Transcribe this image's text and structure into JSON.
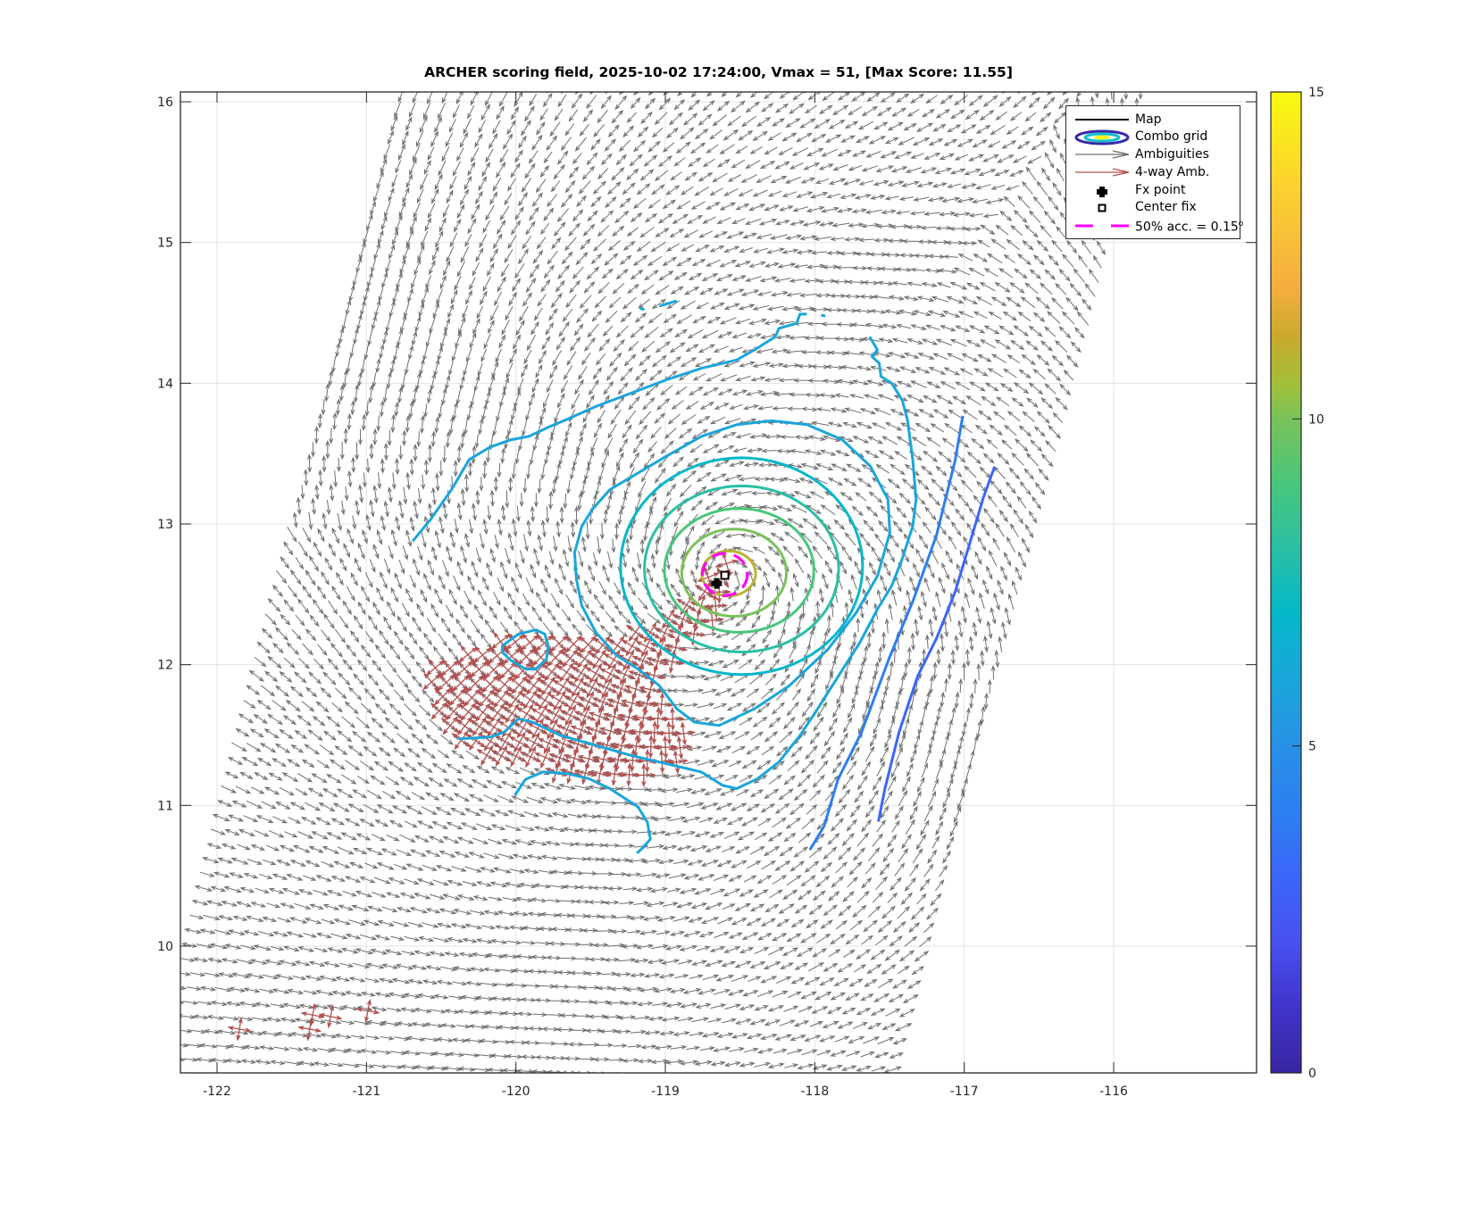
{
  "chart_data": {
    "type": "contour",
    "title": "ARCHER scoring field, 2025-10-02 17:24:00, Vmax = 51, [Max Score: 11.55]",
    "xlabel": "",
    "ylabel": "",
    "xlim": [
      -122.245,
      -115.044
    ],
    "ylim": [
      9.099,
      16.07
    ],
    "grid": true,
    "xticks": [
      -122,
      -121,
      -120,
      -119,
      -118,
      -117,
      -116
    ],
    "xtick_labels": [
      "-122",
      "-121",
      "-120",
      "-119",
      "-118",
      "-117",
      "-116"
    ],
    "yticks": [
      10,
      11,
      12,
      13,
      14,
      15,
      16
    ],
    "ytick_labels": [
      "10",
      "11",
      "12",
      "13",
      "14",
      "15",
      "16"
    ],
    "legend": {
      "placement": "top-right",
      "entries": [
        {
          "label": "Map",
          "symbol": "line"
        },
        {
          "label": "Combo grid",
          "symbol": "ellipses"
        },
        {
          "label": "Ambiguities",
          "symbol": "gray-arrow"
        },
        {
          "label": "4-way Amb.",
          "symbol": "red-arrow"
        },
        {
          "label": "Fx point",
          "symbol": "filled-marker"
        },
        {
          "label": "Center fix",
          "symbol": "open-square"
        },
        {
          "label": "50% acc. = 0.15",
          "sup": "o",
          "symbol": "magenta-dash"
        }
      ]
    },
    "colorbar": {
      "range": [
        0,
        15
      ],
      "ticks": [
        0,
        5,
        10,
        15
      ],
      "tick_labels": [
        "0",
        "5",
        "10",
        "15"
      ],
      "colormap": [
        [
          0,
          "#3826a0"
        ],
        [
          0.07,
          "#4034cc"
        ],
        [
          0.13,
          "#4850ee"
        ],
        [
          0.2,
          "#3c66f8"
        ],
        [
          0.27,
          "#2c80f0"
        ],
        [
          0.33,
          "#2890e6"
        ],
        [
          0.4,
          "#1aa6da"
        ],
        [
          0.47,
          "#04b8c8"
        ],
        [
          0.53,
          "#28bfa6"
        ],
        [
          0.6,
          "#48c67c"
        ],
        [
          0.667,
          "#7ac25a"
        ],
        [
          0.7,
          "#a0c03a"
        ],
        [
          0.75,
          "#c8aa2c"
        ],
        [
          0.8,
          "#f4ae40"
        ],
        [
          0.9,
          "#fcd030"
        ],
        [
          1,
          "#f9fa10"
        ]
      ]
    },
    "contours": [
      {
        "level": 11,
        "shape": "ellipse",
        "center": [
          -118.576,
          12.648
        ],
        "radii": [
          0.18,
          0.16
        ]
      },
      {
        "level": 10,
        "shape": "ellipse",
        "center": [
          -118.54,
          12.654
        ],
        "radii": [
          0.35,
          0.31
        ]
      },
      {
        "level": 9,
        "shape": "ellipse",
        "center": [
          -118.506,
          12.67
        ],
        "radii": [
          0.5,
          0.44
        ]
      },
      {
        "level": 8,
        "shape": "ellipse",
        "center": [
          -118.49,
          12.68
        ],
        "radii": [
          0.65,
          0.59
        ]
      },
      {
        "level": 7,
        "shape": "ellipse",
        "center": [
          -118.49,
          12.7
        ],
        "radii": [
          0.81,
          0.77
        ]
      },
      {
        "level": 6,
        "closed": true,
        "points": [
          [
            -119.489,
            13.103
          ],
          [
            -119.371,
            13.244
          ],
          [
            -119.183,
            13.362
          ],
          [
            -118.994,
            13.481
          ],
          [
            -118.759,
            13.622
          ],
          [
            -118.523,
            13.705
          ],
          [
            -118.287,
            13.733
          ],
          [
            -118.052,
            13.705
          ],
          [
            -117.816,
            13.599
          ],
          [
            -117.628,
            13.41
          ],
          [
            -117.51,
            13.174
          ],
          [
            -117.498,
            12.937
          ],
          [
            -117.581,
            12.63
          ],
          [
            -117.722,
            12.371
          ],
          [
            -117.91,
            12.111
          ],
          [
            -118.17,
            11.851
          ],
          [
            -118.405,
            11.686
          ],
          [
            -118.641,
            11.568
          ],
          [
            -118.806,
            11.592
          ],
          [
            -118.923,
            11.686
          ],
          [
            -119.041,
            11.851
          ],
          [
            -119.183,
            11.969
          ],
          [
            -119.324,
            12.064
          ],
          [
            -119.465,
            12.229
          ],
          [
            -119.559,
            12.418
          ],
          [
            -119.595,
            12.607
          ],
          [
            -119.607,
            12.796
          ],
          [
            -119.559,
            12.985
          ]
        ]
      },
      {
        "level": 6,
        "closed": false,
        "points": [
          [
            -120.69,
            12.878
          ],
          [
            -120.572,
            13.031
          ],
          [
            -120.431,
            13.244
          ],
          [
            -120.313,
            13.457
          ],
          [
            -120.172,
            13.547
          ],
          [
            -120.031,
            13.599
          ],
          [
            -119.913,
            13.622
          ],
          [
            -119.771,
            13.693
          ],
          [
            -119.654,
            13.745
          ],
          [
            -119.465,
            13.835
          ],
          [
            -119.23,
            13.929
          ],
          [
            -118.994,
            14.024
          ],
          [
            -118.758,
            14.106
          ],
          [
            -118.523,
            14.165
          ],
          [
            -118.405,
            14.236
          ],
          [
            -118.264,
            14.331
          ],
          [
            -118.24,
            14.39
          ],
          [
            -118.122,
            14.425
          ],
          [
            -118.099,
            14.491
          ],
          [
            -118.052,
            14.491
          ]
        ]
      },
      {
        "level": 6,
        "closed": false,
        "points": [
          [
            -117.958,
            14.484
          ],
          [
            -117.929,
            14.477
          ]
        ]
      },
      {
        "level": 6,
        "closed": false,
        "points": [
          [
            -119.171,
            14.531
          ],
          [
            -119.14,
            14.524
          ]
        ]
      },
      {
        "level": 6,
        "closed": false,
        "points": [
          [
            -119.041,
            14.548
          ],
          [
            -118.923,
            14.586
          ]
        ]
      },
      {
        "level": 6,
        "closed": false,
        "points": [
          [
            -117.633,
            14.331
          ],
          [
            -117.581,
            14.236
          ],
          [
            -117.617,
            14.189
          ],
          [
            -117.569,
            14.142
          ],
          [
            -117.557,
            14.047
          ],
          [
            -117.486,
            14.0
          ],
          [
            -117.416,
            13.882
          ],
          [
            -117.38,
            13.74
          ],
          [
            -117.345,
            13.457
          ],
          [
            -117.322,
            13.174
          ],
          [
            -117.345,
            12.985
          ],
          [
            -117.416,
            12.749
          ],
          [
            -117.486,
            12.56
          ],
          [
            -117.581,
            12.394
          ],
          [
            -117.698,
            12.158
          ],
          [
            -117.84,
            11.922
          ],
          [
            -117.981,
            11.686
          ],
          [
            -118.099,
            11.497
          ],
          [
            -118.24,
            11.308
          ],
          [
            -118.382,
            11.19
          ],
          [
            -118.523,
            11.119
          ],
          [
            -118.617,
            11.143
          ],
          [
            -118.759,
            11.237
          ],
          [
            -118.947,
            11.285
          ],
          [
            -119.23,
            11.355
          ],
          [
            -119.465,
            11.426
          ],
          [
            -119.701,
            11.497
          ],
          [
            -119.889,
            11.592
          ],
          [
            -119.984,
            11.615
          ],
          [
            -120.078,
            11.521
          ],
          [
            -120.172,
            11.485
          ],
          [
            -120.384,
            11.473
          ]
        ]
      },
      {
        "level": 6,
        "closed": true,
        "points": [
          [
            -120.09,
            12.135
          ],
          [
            -119.984,
            12.217
          ],
          [
            -119.866,
            12.248
          ],
          [
            -119.807,
            12.217
          ],
          [
            -119.783,
            12.135
          ],
          [
            -119.795,
            12.04
          ],
          [
            -119.866,
            11.969
          ],
          [
            -119.936,
            11.969
          ],
          [
            -120.031,
            12.028
          ],
          [
            -120.09,
            12.087
          ]
        ]
      },
      {
        "level": 6,
        "closed": false,
        "points": [
          [
            -120.007,
            11.072
          ],
          [
            -119.936,
            11.185
          ],
          [
            -119.819,
            11.237
          ],
          [
            -119.654,
            11.225
          ],
          [
            -119.512,
            11.19
          ],
          [
            -119.371,
            11.119
          ],
          [
            -119.183,
            10.989
          ],
          [
            -119.12,
            10.88
          ],
          [
            -119.1,
            10.76
          ],
          [
            -119.15,
            10.7
          ],
          [
            -119.19,
            10.66
          ]
        ]
      },
      {
        "level": 4,
        "closed": false,
        "points": [
          [
            -118.033,
            10.684
          ],
          [
            -117.939,
            10.85
          ],
          [
            -117.845,
            11.184
          ],
          [
            -117.688,
            11.518
          ],
          [
            -117.5,
            12.052
          ],
          [
            -117.343,
            12.453
          ],
          [
            -117.186,
            12.92
          ],
          [
            -117.06,
            13.454
          ],
          [
            -117.01,
            13.768
          ]
        ]
      },
      {
        "level": 3,
        "closed": false,
        "points": [
          [
            -117.575,
            10.884
          ],
          [
            -117.531,
            11.117
          ],
          [
            -117.437,
            11.518
          ],
          [
            -117.311,
            11.919
          ],
          [
            -117.186,
            12.186
          ],
          [
            -117.06,
            12.519
          ],
          [
            -116.966,
            12.853
          ],
          [
            -116.872,
            13.187
          ],
          [
            -116.797,
            13.407
          ]
        ]
      }
    ],
    "fx_point": [
      -118.657,
      12.577
    ],
    "center_fix": [
      -118.602,
      12.635
    ],
    "accuracy_circle": {
      "center": [
        -118.602,
        12.641
      ],
      "radius_deg": 0.15
    },
    "wind_field": {
      "storm_center": [
        -118.6,
        12.62
      ],
      "swath_corners": {
        "top_left": [
          -120.72,
          16.25
        ],
        "top_right": [
          -115.82,
          16.25
        ],
        "bottom_left": [
          -122.42,
          9.0
        ],
        "bottom_right": [
          -117.55,
          9.0
        ]
      },
      "cells_across": 50,
      "cells_along": 72,
      "inflow_angle_deg": 22
    },
    "four_way_region": [
      [
        -120.6,
        12.01
      ],
      [
        -119.88,
        12.25
      ],
      [
        -119.38,
        12.18
      ],
      [
        -118.81,
        12.45
      ],
      [
        -118.65,
        12.78
      ],
      [
        -118.5,
        12.72
      ],
      [
        -118.62,
        12.32
      ],
      [
        -119.06,
        11.91
      ],
      [
        -118.81,
        11.38
      ],
      [
        -119.12,
        11.18
      ],
      [
        -119.94,
        11.25
      ],
      [
        -120.35,
        11.38
      ],
      [
        -120.54,
        11.58
      ],
      [
        -120.57,
        11.78
      ]
    ],
    "four_way_points": [
      [
        -121.85,
        9.41
      ],
      [
        -121.36,
        9.51
      ],
      [
        -121.24,
        9.5
      ],
      [
        -121.38,
        9.41
      ],
      [
        -120.99,
        9.54
      ]
    ],
    "colors": {
      "ambiguity": "#6e6e6e",
      "four_way": "#b05050",
      "accuracy": "#ff00ff",
      "map": "#000000",
      "axes": "#262626",
      "grid": "#e3e3e3"
    }
  }
}
